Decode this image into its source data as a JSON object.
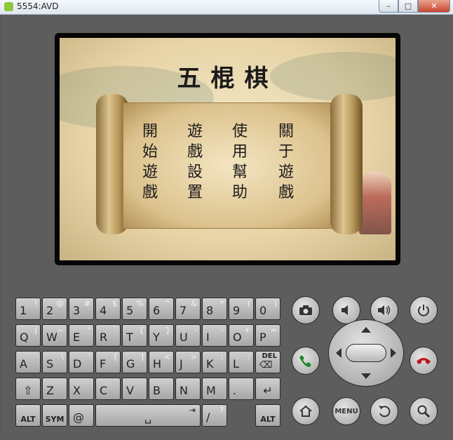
{
  "window": {
    "title": "5554:AVD"
  },
  "game": {
    "title": "五棍棋",
    "menu": [
      {
        "label": "開始遊戲"
      },
      {
        "label": "遊戲設置"
      },
      {
        "label": "使用幫助"
      },
      {
        "label": "關于遊戲"
      }
    ]
  },
  "keyboard": {
    "rows": [
      [
        {
          "main": "1",
          "alt": "!"
        },
        {
          "main": "2",
          "alt": "@"
        },
        {
          "main": "3",
          "alt": "#"
        },
        {
          "main": "4",
          "alt": "$"
        },
        {
          "main": "5",
          "alt": "%"
        },
        {
          "main": "6",
          "alt": "^"
        },
        {
          "main": "7",
          "alt": "&"
        },
        {
          "main": "8",
          "alt": "*"
        },
        {
          "main": "9",
          "alt": "("
        },
        {
          "main": "0",
          "alt": ")"
        }
      ],
      [
        {
          "main": "Q",
          "alt": "|"
        },
        {
          "main": "W",
          "alt": "~"
        },
        {
          "main": "E",
          "alt": "\""
        },
        {
          "main": "R",
          "alt": "`"
        },
        {
          "main": "T",
          "alt": "{"
        },
        {
          "main": "Y",
          "alt": "}"
        },
        {
          "main": "U",
          "alt": "-"
        },
        {
          "main": "I",
          "alt": "-"
        },
        {
          "main": "O",
          "alt": "+"
        },
        {
          "main": "P",
          "alt": "="
        }
      ],
      [
        {
          "main": "A",
          "alt": ""
        },
        {
          "main": "S",
          "alt": "\\"
        },
        {
          "main": "D",
          "alt": "'"
        },
        {
          "main": "F",
          "alt": "["
        },
        {
          "main": "G",
          "alt": "]"
        },
        {
          "main": "H",
          "alt": "<"
        },
        {
          "main": "J",
          "alt": ">"
        },
        {
          "main": "K",
          "alt": ";"
        },
        {
          "main": "L",
          "alt": ":"
        },
        {
          "main": "",
          "alt": "DEL"
        }
      ],
      [
        {
          "main": "",
          "alt": ""
        },
        {
          "main": "Z",
          "alt": ""
        },
        {
          "main": "X",
          "alt": ""
        },
        {
          "main": "C",
          "alt": ""
        },
        {
          "main": "V",
          "alt": ""
        },
        {
          "main": "B",
          "alt": ""
        },
        {
          "main": "N",
          "alt": ""
        },
        {
          "main": "M",
          "alt": ""
        },
        {
          "main": ".",
          "alt": ""
        },
        {
          "main": "",
          "alt": ""
        }
      ]
    ],
    "bottom": {
      "alt_left": "ALT",
      "sym": "SYM",
      "at": "@",
      "slash": "/",
      "slash_alt": "?",
      "alt_right": "ALT"
    }
  },
  "controls": {
    "camera": "camera-icon",
    "volume_down": "volume-down-icon",
    "volume_up": "volume-up-icon",
    "power": "power-icon",
    "call": "call-icon",
    "end_call": "end-call-icon",
    "home": "home-icon",
    "menu_label": "MENU",
    "back": "back-icon",
    "search": "search-icon"
  }
}
